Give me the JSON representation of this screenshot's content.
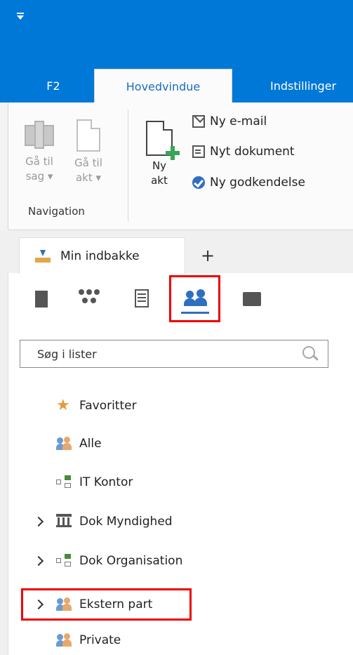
{
  "ribbon": {
    "tabs": [
      "F2",
      "Hovedvindue",
      "Indstillinger"
    ],
    "active_tab": "Hovedvindue",
    "navigation_group": {
      "label": "Navigation",
      "go_to_case_line1": "Gå til",
      "go_to_case_line2": "sag ▾",
      "go_to_doc_line1": "Gå til",
      "go_to_doc_line2": "akt ▾"
    },
    "new_act_line1": "Ny",
    "new_act_line2": "akt",
    "small_buttons": [
      "Ny e-mail",
      "Nyt dokument",
      "Ny godkendelse"
    ]
  },
  "panel": {
    "inbox_tab": "Min indbakke",
    "add_tab": "+",
    "search_placeholder": "Søg i lister",
    "list_items": [
      {
        "label": "Favoritter",
        "icon": "star-icon",
        "expandable": false
      },
      {
        "label": "Alle",
        "icon": "people-icon",
        "expandable": false
      },
      {
        "label": "IT Kontor",
        "icon": "org-unit-icon",
        "expandable": false
      },
      {
        "label": "Dok Myndighed",
        "icon": "authority-building-icon",
        "expandable": true
      },
      {
        "label": "Dok Organisation",
        "icon": "org-unit-icon",
        "expandable": true
      },
      {
        "label": "Ekstern part",
        "icon": "people-icon",
        "expandable": true
      },
      {
        "label": "Private",
        "icon": "people-icon",
        "expandable": false
      }
    ]
  },
  "colors": {
    "titlebar": "#0078d7",
    "accent": "#2f6fbf",
    "highlight": "#e00000"
  }
}
